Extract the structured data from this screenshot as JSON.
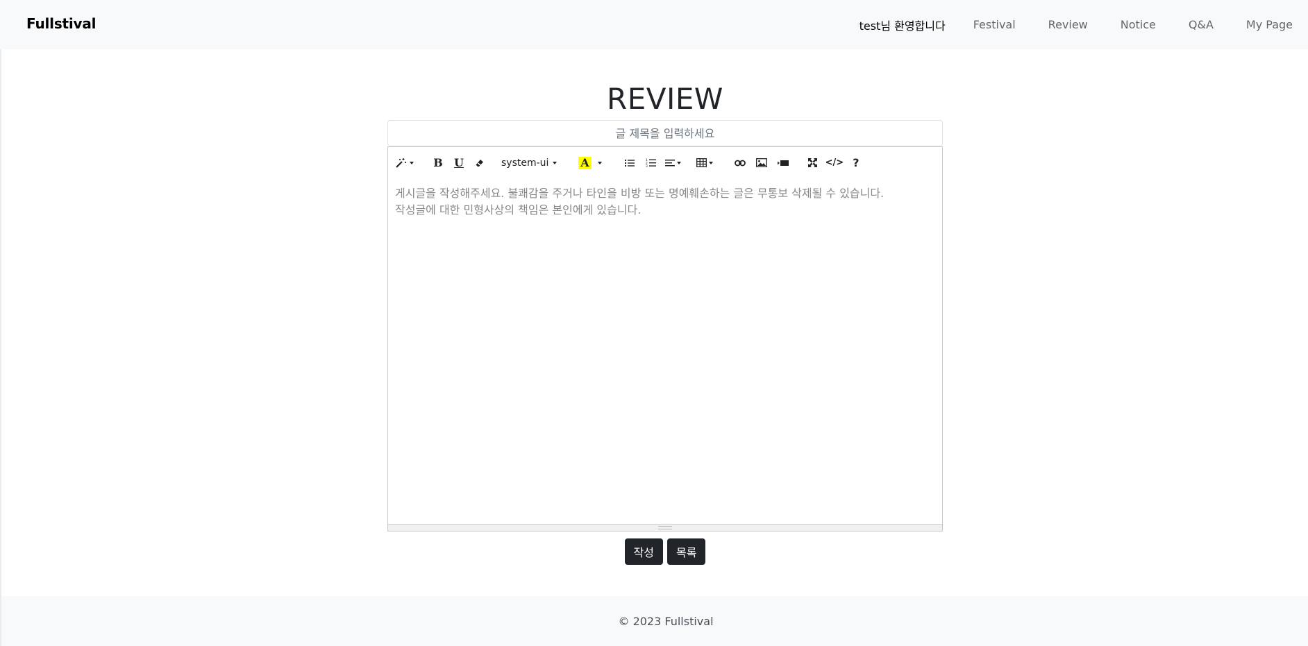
{
  "header": {
    "brand": "Fullstival",
    "welcome": "test님 환영합니다",
    "nav_items": [
      "Festival",
      "Review",
      "Notice",
      "Q&A",
      "My Page"
    ]
  },
  "page": {
    "title": "REVIEW",
    "title_placeholder": "글 제목을 입력하세요"
  },
  "editor": {
    "toolbar": {
      "font_name": "system-ui",
      "bold_label": "B",
      "underline_label": "U",
      "color_label": "A",
      "code_label": "</>",
      "help_label": "?",
      "highlight_color": "#ffff00"
    },
    "placeholder_lines": [
      "게시글을 작성해주세요. 불쾌감을 주거나 타인을 비방 또는 명예훼손하는 글은 무통보 삭제될 수 있습니다.",
      "작성글에 대한 민형사상의 책임은 본인에게 있습니다."
    ]
  },
  "actions": {
    "submit_label": "작성",
    "list_label": "목록"
  },
  "footer": {
    "copyright": "© 2023 Fullstival"
  }
}
